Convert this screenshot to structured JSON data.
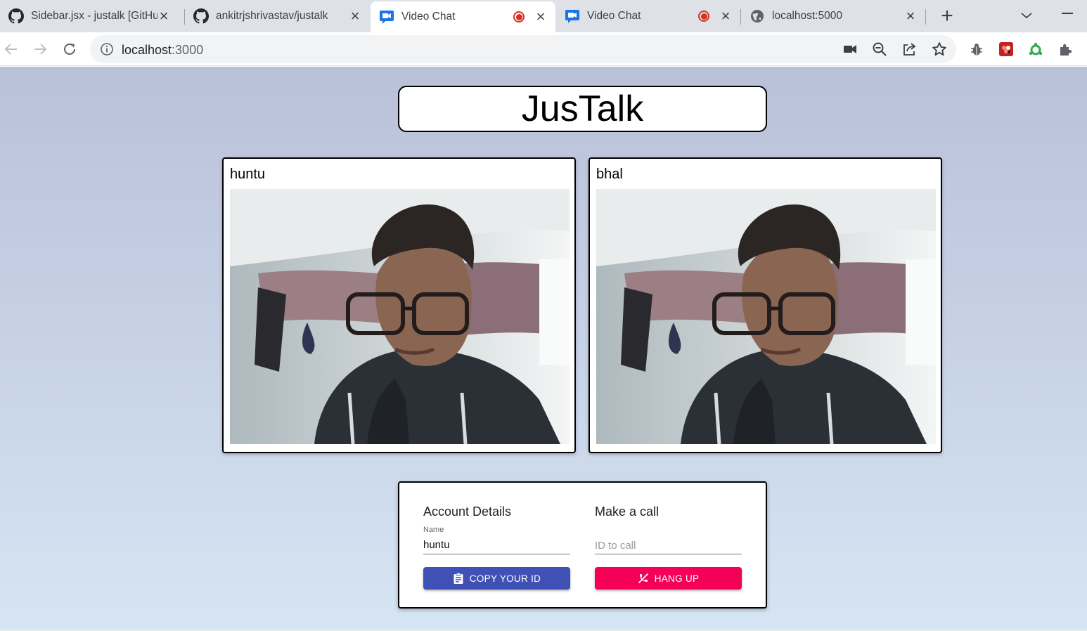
{
  "browser": {
    "tabs": [
      {
        "title": "Sidebar.jsx - justalk [GitHub]",
        "icon": "github-icon",
        "active": false,
        "recording": false
      },
      {
        "title": "ankitrjshrivastav/justalk",
        "icon": "github-icon",
        "active": false,
        "recording": false
      },
      {
        "title": "Video Chat",
        "icon": "video-chat-icon",
        "active": true,
        "recording": true
      },
      {
        "title": "Video Chat",
        "icon": "video-chat-icon",
        "active": false,
        "recording": true
      },
      {
        "title": "localhost:5000",
        "icon": "globe-icon",
        "active": false,
        "recording": false
      }
    ],
    "close_glyph": "×",
    "new_tab_glyph": "+",
    "address": {
      "host": "localhost",
      "port": ":3000"
    }
  },
  "app": {
    "title": "JusTalk",
    "videos": [
      {
        "name": "huntu"
      },
      {
        "name": "bhal"
      }
    ],
    "account": {
      "heading": "Account Details",
      "name_label": "Name",
      "name_value": "huntu",
      "copy_button": "COPY YOUR ID"
    },
    "call": {
      "heading": "Make a call",
      "id_placeholder": "ID to call",
      "hangup_button": "HANG UP"
    }
  },
  "colors": {
    "primary": "#3f51b5",
    "secondary": "#f50057",
    "record": "#d93025"
  }
}
